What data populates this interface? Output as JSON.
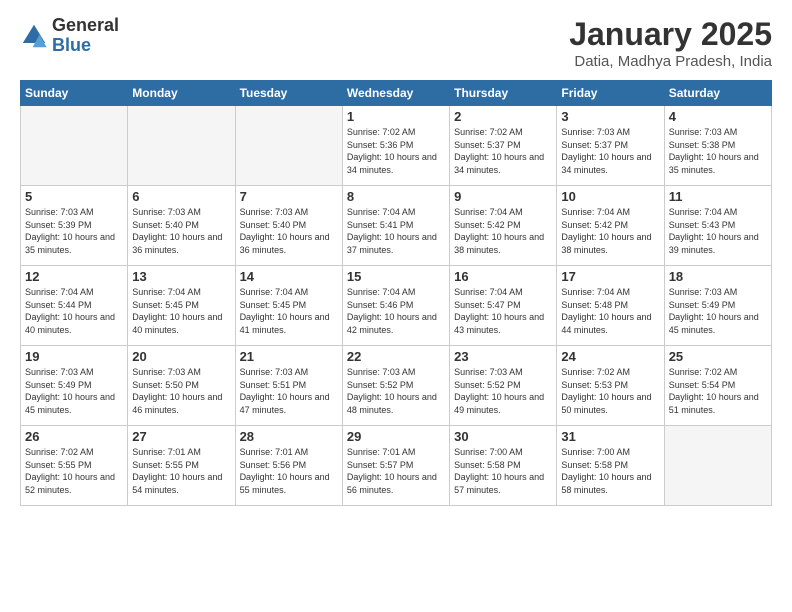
{
  "logo": {
    "general": "General",
    "blue": "Blue"
  },
  "header": {
    "month": "January 2025",
    "location": "Datia, Madhya Pradesh, India"
  },
  "weekdays": [
    "Sunday",
    "Monday",
    "Tuesday",
    "Wednesday",
    "Thursday",
    "Friday",
    "Saturday"
  ],
  "weeks": [
    [
      {
        "day": "",
        "empty": true
      },
      {
        "day": "",
        "empty": true
      },
      {
        "day": "",
        "empty": true
      },
      {
        "day": "1",
        "sunrise": "7:02 AM",
        "sunset": "5:36 PM",
        "daylight": "10 hours and 34 minutes."
      },
      {
        "day": "2",
        "sunrise": "7:02 AM",
        "sunset": "5:37 PM",
        "daylight": "10 hours and 34 minutes."
      },
      {
        "day": "3",
        "sunrise": "7:03 AM",
        "sunset": "5:37 PM",
        "daylight": "10 hours and 34 minutes."
      },
      {
        "day": "4",
        "sunrise": "7:03 AM",
        "sunset": "5:38 PM",
        "daylight": "10 hours and 35 minutes."
      }
    ],
    [
      {
        "day": "5",
        "sunrise": "7:03 AM",
        "sunset": "5:39 PM",
        "daylight": "10 hours and 35 minutes."
      },
      {
        "day": "6",
        "sunrise": "7:03 AM",
        "sunset": "5:40 PM",
        "daylight": "10 hours and 36 minutes."
      },
      {
        "day": "7",
        "sunrise": "7:03 AM",
        "sunset": "5:40 PM",
        "daylight": "10 hours and 36 minutes."
      },
      {
        "day": "8",
        "sunrise": "7:04 AM",
        "sunset": "5:41 PM",
        "daylight": "10 hours and 37 minutes."
      },
      {
        "day": "9",
        "sunrise": "7:04 AM",
        "sunset": "5:42 PM",
        "daylight": "10 hours and 38 minutes."
      },
      {
        "day": "10",
        "sunrise": "7:04 AM",
        "sunset": "5:42 PM",
        "daylight": "10 hours and 38 minutes."
      },
      {
        "day": "11",
        "sunrise": "7:04 AM",
        "sunset": "5:43 PM",
        "daylight": "10 hours and 39 minutes."
      }
    ],
    [
      {
        "day": "12",
        "sunrise": "7:04 AM",
        "sunset": "5:44 PM",
        "daylight": "10 hours and 40 minutes."
      },
      {
        "day": "13",
        "sunrise": "7:04 AM",
        "sunset": "5:45 PM",
        "daylight": "10 hours and 40 minutes."
      },
      {
        "day": "14",
        "sunrise": "7:04 AM",
        "sunset": "5:45 PM",
        "daylight": "10 hours and 41 minutes."
      },
      {
        "day": "15",
        "sunrise": "7:04 AM",
        "sunset": "5:46 PM",
        "daylight": "10 hours and 42 minutes."
      },
      {
        "day": "16",
        "sunrise": "7:04 AM",
        "sunset": "5:47 PM",
        "daylight": "10 hours and 43 minutes."
      },
      {
        "day": "17",
        "sunrise": "7:04 AM",
        "sunset": "5:48 PM",
        "daylight": "10 hours and 44 minutes."
      },
      {
        "day": "18",
        "sunrise": "7:03 AM",
        "sunset": "5:49 PM",
        "daylight": "10 hours and 45 minutes."
      }
    ],
    [
      {
        "day": "19",
        "sunrise": "7:03 AM",
        "sunset": "5:49 PM",
        "daylight": "10 hours and 45 minutes."
      },
      {
        "day": "20",
        "sunrise": "7:03 AM",
        "sunset": "5:50 PM",
        "daylight": "10 hours and 46 minutes."
      },
      {
        "day": "21",
        "sunrise": "7:03 AM",
        "sunset": "5:51 PM",
        "daylight": "10 hours and 47 minutes."
      },
      {
        "day": "22",
        "sunrise": "7:03 AM",
        "sunset": "5:52 PM",
        "daylight": "10 hours and 48 minutes."
      },
      {
        "day": "23",
        "sunrise": "7:03 AM",
        "sunset": "5:52 PM",
        "daylight": "10 hours and 49 minutes."
      },
      {
        "day": "24",
        "sunrise": "7:02 AM",
        "sunset": "5:53 PM",
        "daylight": "10 hours and 50 minutes."
      },
      {
        "day": "25",
        "sunrise": "7:02 AM",
        "sunset": "5:54 PM",
        "daylight": "10 hours and 51 minutes."
      }
    ],
    [
      {
        "day": "26",
        "sunrise": "7:02 AM",
        "sunset": "5:55 PM",
        "daylight": "10 hours and 52 minutes."
      },
      {
        "day": "27",
        "sunrise": "7:01 AM",
        "sunset": "5:55 PM",
        "daylight": "10 hours and 54 minutes."
      },
      {
        "day": "28",
        "sunrise": "7:01 AM",
        "sunset": "5:56 PM",
        "daylight": "10 hours and 55 minutes."
      },
      {
        "day": "29",
        "sunrise": "7:01 AM",
        "sunset": "5:57 PM",
        "daylight": "10 hours and 56 minutes."
      },
      {
        "day": "30",
        "sunrise": "7:00 AM",
        "sunset": "5:58 PM",
        "daylight": "10 hours and 57 minutes."
      },
      {
        "day": "31",
        "sunrise": "7:00 AM",
        "sunset": "5:58 PM",
        "daylight": "10 hours and 58 minutes."
      },
      {
        "day": "",
        "empty": true
      }
    ]
  ]
}
